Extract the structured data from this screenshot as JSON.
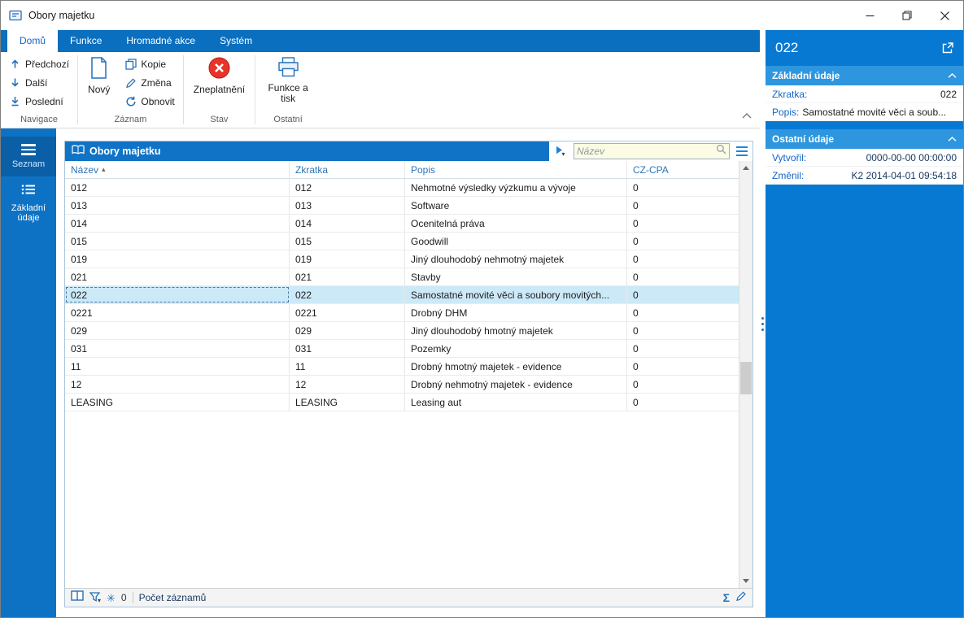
{
  "window": {
    "title": "Obory majetku"
  },
  "icons": {
    "sum": "Σ",
    "snowflake": "✳",
    "sort_asc": "▴",
    "caret_down": "▾"
  },
  "ribbon": {
    "tabs": [
      {
        "label": "Domů",
        "active": true
      },
      {
        "label": "Funkce",
        "active": false
      },
      {
        "label": "Hromadné akce",
        "active": false
      },
      {
        "label": "Systém",
        "active": false
      }
    ],
    "groups": {
      "navigace": {
        "label": "Navigace",
        "items": [
          {
            "label": "Předchozí",
            "icon": "arrow-up-icon"
          },
          {
            "label": "Další",
            "icon": "arrow-down-icon"
          },
          {
            "label": "Poslední",
            "icon": "arrow-down-bar-icon"
          }
        ]
      },
      "zaznam": {
        "label": "Záznam",
        "big": {
          "label": "Nový",
          "icon": "new-document-icon"
        },
        "items": [
          {
            "label": "Kopie",
            "icon": "copy-icon"
          },
          {
            "label": "Změna",
            "icon": "edit-icon"
          },
          {
            "label": "Obnovit",
            "icon": "refresh-icon"
          }
        ]
      },
      "stav": {
        "label": "Stav",
        "big": {
          "label": "Zneplatnění",
          "icon": "invalidate-icon"
        }
      },
      "ostatni": {
        "label": "Ostatní",
        "big": {
          "label": "Funkce a tisk",
          "icon": "print-icon"
        }
      }
    }
  },
  "sidebar": {
    "items": [
      {
        "label": "Seznam",
        "icon": "menu-icon",
        "active": true
      },
      {
        "label": "Základní údaje",
        "icon": "list-icon",
        "active": false
      }
    ]
  },
  "table": {
    "title": "Obory majetku",
    "search": {
      "placeholder": "Název"
    },
    "columns": [
      {
        "label": "Název",
        "sort": "asc"
      },
      {
        "label": "Zkratka"
      },
      {
        "label": "Popis"
      },
      {
        "label": "CZ-CPA"
      }
    ],
    "rows": [
      [
        "012",
        "012",
        "Nehmotné výsledky výzkumu a vývoje",
        "0"
      ],
      [
        "013",
        "013",
        "Software",
        "0"
      ],
      [
        "014",
        "014",
        "Ocenitelná práva",
        "0"
      ],
      [
        "015",
        "015",
        "Goodwill",
        "0"
      ],
      [
        "019",
        "019",
        "Jiný dlouhodobý nehmotný majetek",
        "0"
      ],
      [
        "021",
        "021",
        "Stavby",
        "0"
      ],
      [
        "022",
        "022",
        "Samostatné movité věci a soubory movitých...",
        "0"
      ],
      [
        "0221",
        "0221",
        "Drobný DHM",
        "0"
      ],
      [
        "029",
        "029",
        "Jiný dlouhodobý hmotný majetek",
        "0"
      ],
      [
        "031",
        "031",
        "Pozemky",
        "0"
      ],
      [
        "11",
        "11",
        "Drobný hmotný majetek - evidence",
        "0"
      ],
      [
        "12",
        "12",
        "Drobný nehmotný majetek - evidence",
        "0"
      ],
      [
        "LEASING",
        "LEASING",
        "Leasing aut",
        "0"
      ]
    ],
    "selected_row": 6,
    "statusbar": {
      "filter_count": "0",
      "count_label": "Počet záznamů"
    }
  },
  "detail": {
    "title": "022",
    "sections": [
      {
        "title": "Základní údaje",
        "fields": [
          {
            "label": "Zkratka:",
            "value": "022"
          },
          {
            "label": "Popis:",
            "value": "Samostatné movité věci a soub..."
          }
        ]
      },
      {
        "title": "Ostatní údaje",
        "fields": [
          {
            "label": "Vytvořil:",
            "value": "0000-00-00 00:00:00"
          },
          {
            "label": "Změnil:",
            "value": "K2 2014-04-01 09:54:18"
          }
        ]
      }
    ]
  },
  "colors": {
    "ribbon_blue": "#0b6fbf",
    "sidebar_blue": "#0e72c4",
    "panel_blue": "#0879d3",
    "section_blue": "#2e96df",
    "label_blue": "#1464c8",
    "selected_row": "#cce9f8",
    "invalid_red": "#e8332a",
    "search_bg": "#fcfbe3"
  }
}
